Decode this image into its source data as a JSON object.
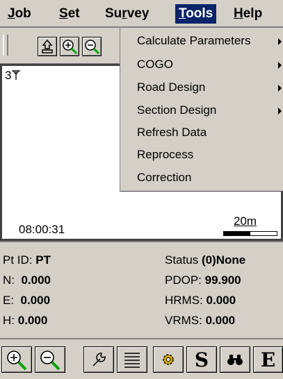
{
  "menubar": {
    "items": [
      {
        "label": "Job",
        "underline": "J"
      },
      {
        "label": "Set",
        "underline": "S"
      },
      {
        "label": "Survey",
        "underline": "r"
      },
      {
        "label": "Tools",
        "underline": "T"
      },
      {
        "label": "Help",
        "underline": "H"
      }
    ],
    "active_index": 3
  },
  "toolbar": {
    "icons": [
      "home-up-icon",
      "zoom-in-icon",
      "zoom-out-icon"
    ]
  },
  "dropdown": {
    "items": [
      {
        "label": "Calculate Parameters",
        "submenu": true
      },
      {
        "label": "COGO",
        "submenu": true
      },
      {
        "label": "Road Design",
        "submenu": true
      },
      {
        "label": "Section Design",
        "submenu": true
      },
      {
        "label": "Refresh Data",
        "submenu": false
      },
      {
        "label": "Reprocess",
        "submenu": false
      },
      {
        "label": "Correction",
        "submenu": false
      }
    ]
  },
  "map": {
    "point_label": "3",
    "time": "08:00:31",
    "scale": "20m"
  },
  "status": {
    "pt_id_label": "Pt ID:",
    "pt_id_value": "PT",
    "n_label": "N:",
    "n_value": "0.000",
    "e_label": "E:",
    "e_value": "0.000",
    "h_label": "H:",
    "h_value": "0.000",
    "status_label": "Status",
    "status_value": "(0)None",
    "pdop_label": "PDOP:",
    "pdop_value": "99.900",
    "hrms_label": "HRMS:",
    "hrms_value": "0.000",
    "vrms_label": "VRMS:",
    "vrms_value": "0.000"
  },
  "bottombar": {
    "buttons": [
      {
        "icon": "zoom-in-icon"
      },
      {
        "icon": "zoom-out-icon"
      },
      {
        "icon": "wrench-icon"
      },
      {
        "icon": "list-icon"
      },
      {
        "icon": "gear-icon"
      },
      {
        "text": "S"
      },
      {
        "icon": "binoculars-icon"
      },
      {
        "text": "E"
      }
    ]
  },
  "colors": {
    "menu_active_bg": "#0a246a",
    "chrome": "#d4d0c8",
    "zoom_green": "#00a000"
  }
}
